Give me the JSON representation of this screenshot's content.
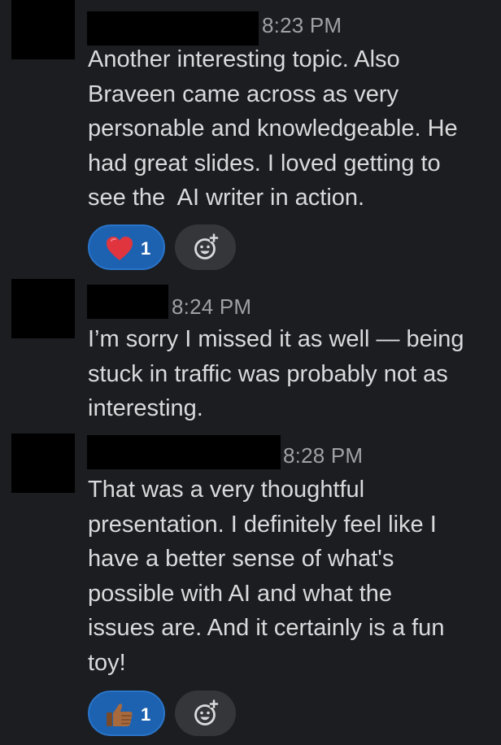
{
  "messages": [
    {
      "time": "8:23 PM",
      "text": "Another interesting topic. Also\nBraveen came across as very\npersonable and knowledgeable. He\nhad great slides. I loved getting to\nsee the  AI writer in action.",
      "reaction": {
        "emoji": "heart-icon",
        "count": "1"
      }
    },
    {
      "time": "8:24 PM",
      "text": "I’m sorry I missed it as well — being\nstuck in traffic was probably not as\ninteresting."
    },
    {
      "time": "8:28 PM",
      "text": "That was a very thoughtful\npresentation. I definitely feel like I\nhave a better sense of what's\npossible with AI and what the\nissues are. And it certainly is a fun\ntoy!",
      "reaction": {
        "emoji": "thumbs-up-icon",
        "count": "1"
      }
    }
  ],
  "colors": {
    "background": "#1b1d21",
    "text": "#d9dadb",
    "timestamp": "#9fa1a4",
    "reaction_active": "#1d62b0",
    "reaction_add": "#34363a"
  }
}
